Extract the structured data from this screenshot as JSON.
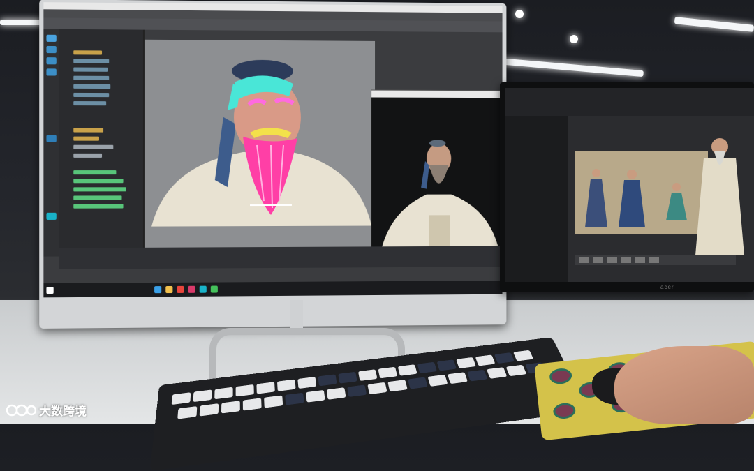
{
  "scene": {
    "left_monitor": {
      "app_title": "",
      "render_window_title": "",
      "figure": "bearded-sage-3d-model"
    },
    "right_monitor": {
      "brand": "acer"
    },
    "watermark": {
      "text": "大数跨境",
      "logo": "kko-logo"
    }
  },
  "colors": {
    "beard_wireframe": "#ff3fa6",
    "hair_wireframe": "#49e6d7",
    "robe": "#e8e2d2",
    "mousepad": "#d4c24a"
  }
}
